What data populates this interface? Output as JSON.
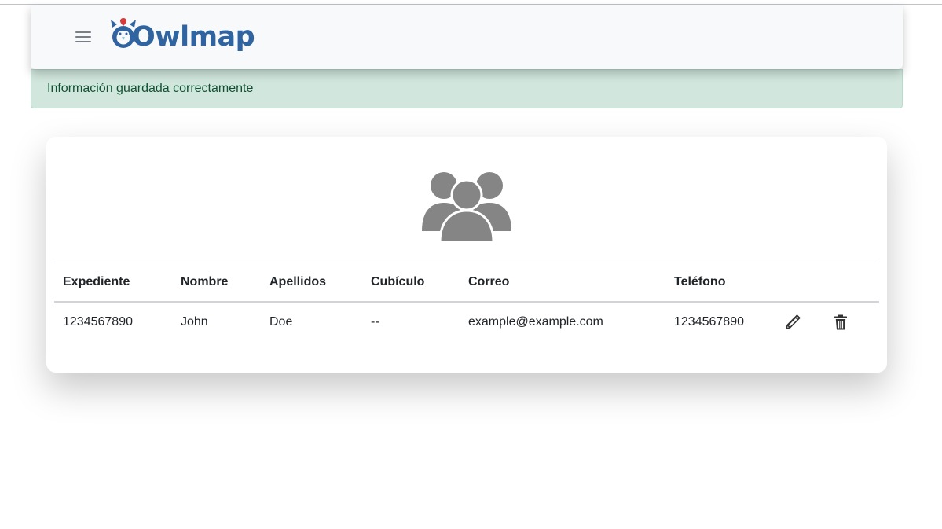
{
  "navbar": {
    "logo_text": "Owlmap",
    "menu_icon": "hamburger-menu-icon"
  },
  "alert": {
    "message": "Información guardada correctamente",
    "color": "#d1e7dd"
  },
  "card": {
    "header_icon": "users-group-icon",
    "table": {
      "columns": [
        "Expediente",
        "Nombre",
        "Apellidos",
        "Cubículo",
        "Correo",
        "Teléfono"
      ],
      "rows": [
        {
          "expediente": "1234567890",
          "nombre": "John",
          "apellidos": "Doe",
          "cubiculo": "--",
          "correo": "example@example.com",
          "telefono": "1234567890",
          "actions": [
            "pencil-edit-icon",
            "trash-delete-icon"
          ]
        }
      ]
    }
  },
  "colors": {
    "brand": "#2f64a1",
    "success_text": "#0f5132",
    "icon_gray": "#858585"
  }
}
